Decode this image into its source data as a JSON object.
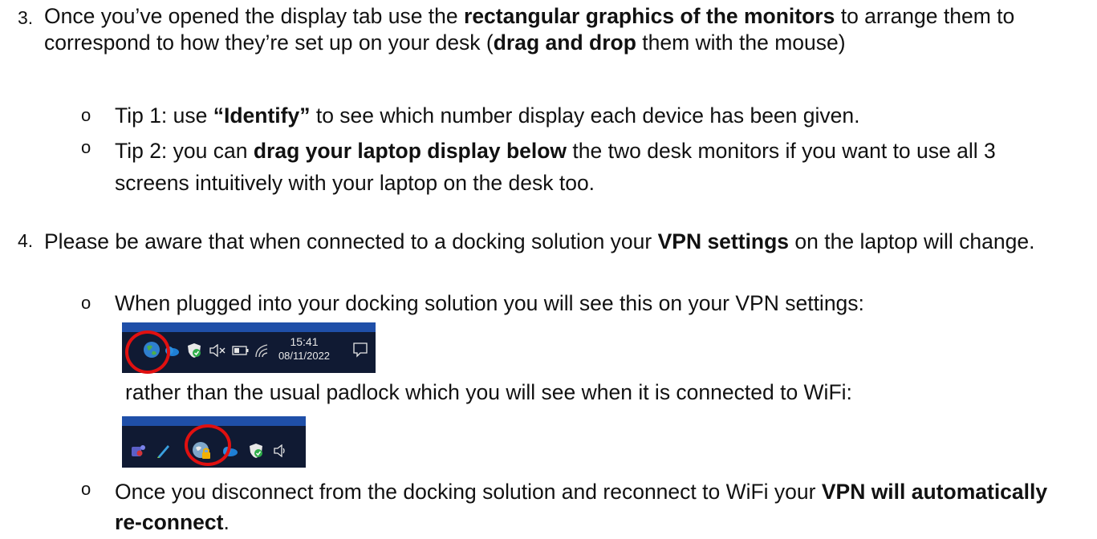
{
  "step3": {
    "number": "3.",
    "text_a": "Once you’ve opened the display tab use the ",
    "bold_a": "rectangular graphics of the monitors",
    "text_b": " to arrange them to correspond to how they’re set up on your desk (",
    "bold_b": "drag and drop",
    "text_c": " them with the mouse)",
    "tip1": {
      "text_a": "Tip 1: use ",
      "bold": "“Identify”",
      "text_b": " to see which number display each device has been given."
    },
    "tip2": {
      "text_a": "Tip 2: you can ",
      "bold": "drag your laptop display below",
      "text_b": " the two desk monitors if you want to use all 3 screens intuitively with your laptop on the desk too."
    }
  },
  "step4": {
    "number": "4.",
    "text_a": "Please be aware that when connected to a docking solution your ",
    "bold_a": "VPN settings",
    "text_b": " on the laptop will change.",
    "bullet1": "When plugged into your docking solution you will see this on your VPN settings:",
    "tray1": {
      "time": "15:41",
      "date": "08/11/2022",
      "icons": [
        "globe-icon",
        "onedrive-cloud-icon",
        "defender-shield-icon",
        "speaker-muted-icon",
        "battery-icon",
        "wifi-icon",
        "notification-icon"
      ]
    },
    "between_text": "rather than the usual padlock which you will see when it is connected to WiFi:",
    "tray2": {
      "icons": [
        "teams-icon",
        "pen-icon",
        "vpn-padlock-icon",
        "onedrive-cloud-icon",
        "defender-shield-icon",
        "speaker-icon"
      ]
    },
    "bullet2": {
      "text_a": "Once you disconnect from the docking solution and reconnect to WiFi your ",
      "bold": "VPN will automatically re-connect",
      "text_b": "."
    }
  },
  "bullet_glyph": "o",
  "colors": {
    "tray_bg": "#101a33",
    "tray_top": "#1f4fa8",
    "highlight_ring": "#e01010",
    "shield_green": "#2fae4a"
  }
}
